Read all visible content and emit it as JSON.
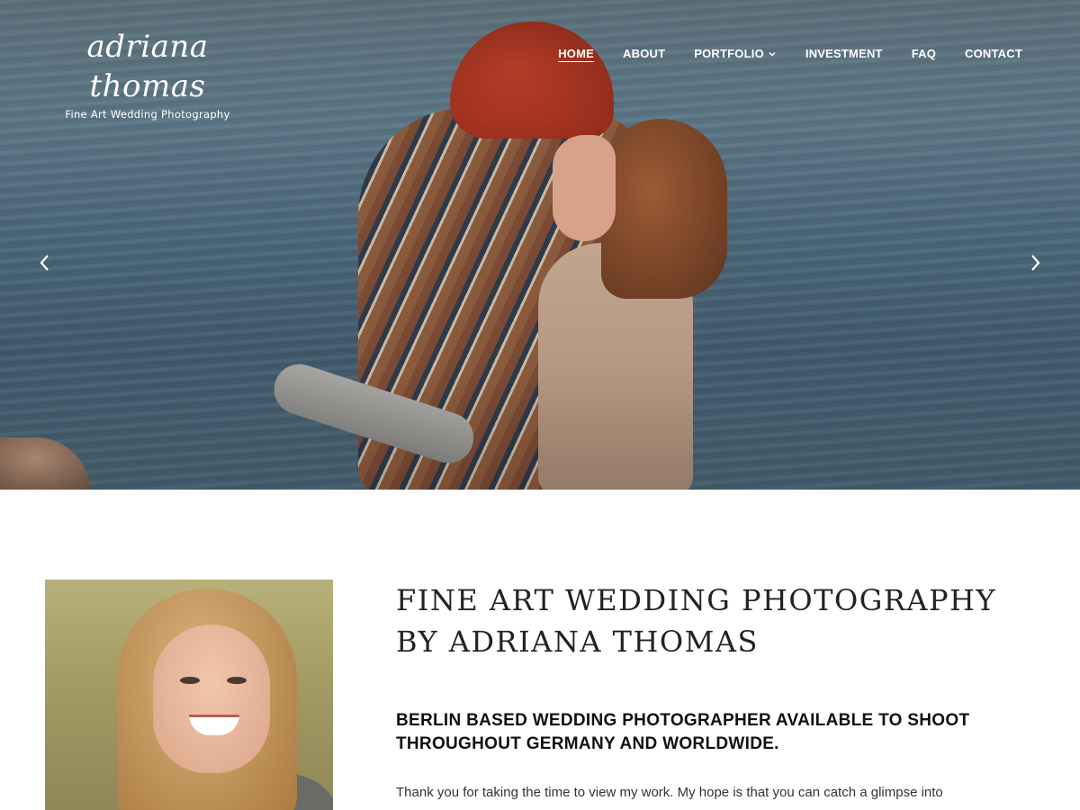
{
  "header": {
    "logo_name": "adriana thomas",
    "logo_tagline": "Fine Art Wedding Photography"
  },
  "nav": {
    "items": [
      {
        "label": "HOME",
        "active": true
      },
      {
        "label": "ABOUT"
      },
      {
        "label": "PORTFOLIO",
        "has_dropdown": true
      },
      {
        "label": "INVESTMENT"
      },
      {
        "label": "FAQ"
      },
      {
        "label": "CONTACT"
      }
    ]
  },
  "hero": {
    "prev_icon": "chevron-left-icon",
    "next_icon": "chevron-right-icon"
  },
  "intro": {
    "heading": "FINE ART WEDDING PHOTOGRAPHY BY ADRIANA THOMAS",
    "subheading": "BERLIN BASED WEDDING PHOTOGRAPHER AVAILABLE TO SHOOT THROUGHOUT GERMANY AND WORLDWIDE.",
    "body": "Thank you for taking the time to view my work. My hope is that you can catch a glimpse into"
  },
  "colors": {
    "nav_text": "#ffffff",
    "heading_text": "#222222",
    "body_text": "#333333"
  }
}
